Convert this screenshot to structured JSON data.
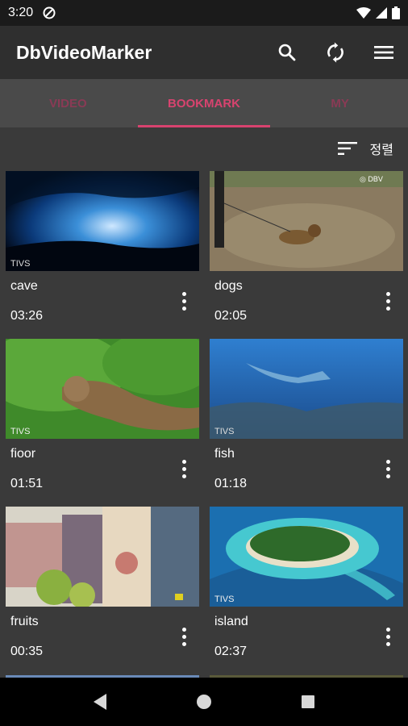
{
  "status_bar": {
    "time": "3:20"
  },
  "app_bar": {
    "title": "DbVideoMarker"
  },
  "tabs": [
    {
      "label": "VIDEO",
      "active": false
    },
    {
      "label": "BOOKMARK",
      "active": true
    },
    {
      "label": "MY",
      "active": false
    }
  ],
  "sort": {
    "label": "정렬"
  },
  "videos": [
    {
      "title": "cave",
      "duration": "03:26"
    },
    {
      "title": "dogs",
      "duration": "02:05"
    },
    {
      "title": "fioor",
      "duration": "01:51"
    },
    {
      "title": "fish",
      "duration": "01:18"
    },
    {
      "title": "fruits",
      "duration": "00:35"
    },
    {
      "title": "island",
      "duration": "02:37"
    }
  ],
  "colors": {
    "accent": "#d8436f",
    "app_bar": "#2f2f2f",
    "tab_bar": "#4a4a4a",
    "background": "#3a3a3a"
  }
}
